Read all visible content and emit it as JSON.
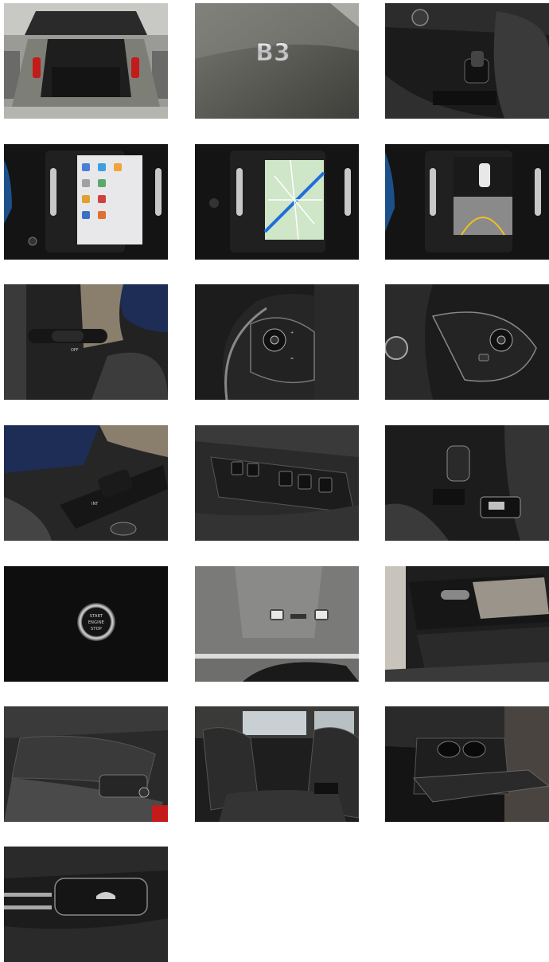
{
  "badge": {
    "text": "B3"
  },
  "engine_button": {
    "line1": "START",
    "line2": "ENGINE",
    "line3": "STOP"
  },
  "stalk_labels": {
    "left_text": "INT",
    "right_text": "OFF"
  },
  "photos": [
    {
      "subject": "open-trunk"
    },
    {
      "subject": "b3-badge"
    },
    {
      "subject": "gear-selector-console"
    },
    {
      "subject": "infotainment-apps"
    },
    {
      "subject": "infotainment-map"
    },
    {
      "subject": "infotainment-camera"
    },
    {
      "subject": "left-stalk"
    },
    {
      "subject": "steering-wheel-left-controls"
    },
    {
      "subject": "steering-wheel-right-controls"
    },
    {
      "subject": "wiper-stalk"
    },
    {
      "subject": "window-switches"
    },
    {
      "subject": "gear-lever"
    },
    {
      "subject": "start-stop-button"
    },
    {
      "subject": "overhead-console"
    },
    {
      "subject": "door-panel"
    },
    {
      "subject": "front-seat-controls"
    },
    {
      "subject": "rear-seats"
    },
    {
      "subject": "rear-armrest-cupholders"
    },
    {
      "subject": "tailgate-button"
    }
  ],
  "colors": {
    "background": "#ffffff",
    "interior_dark": "#1c1c1c",
    "screen_blue": "#1e6fd9",
    "tail_light_red": "#c41a1a"
  }
}
